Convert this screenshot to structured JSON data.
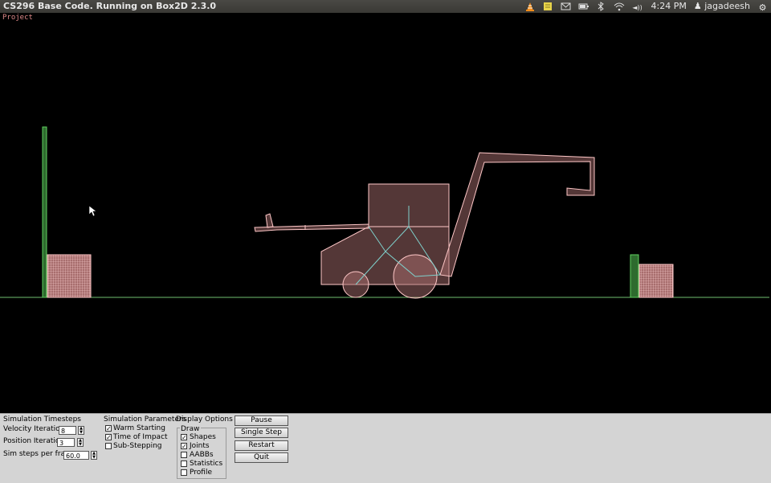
{
  "window": {
    "title": "CS296 Base Code. Running on Box2D 2.3.0"
  },
  "tray": {
    "time": "4:24 PM",
    "user": "jagadeesh",
    "volume_label": "◄))"
  },
  "scene": {
    "overlay_label": "Project"
  },
  "panel": {
    "timesteps": {
      "heading": "Simulation Timesteps",
      "velocity_label": "Velocity Iterations",
      "velocity_value": "8",
      "position_label": "Position Iterations",
      "position_value": "3",
      "steps_label": "Sim steps per frame",
      "steps_value": "60.0"
    },
    "parameters": {
      "heading": "Simulation Parameters",
      "items": [
        {
          "label": "Warm Starting",
          "checked": true
        },
        {
          "label": "Time of Impact",
          "checked": true
        },
        {
          "label": "Sub-Stepping",
          "checked": false
        }
      ]
    },
    "display": {
      "heading": "Display Options",
      "group": "Draw",
      "items": [
        {
          "label": "Shapes",
          "checked": true
        },
        {
          "label": "Joints",
          "checked": true
        },
        {
          "label": "AABBs",
          "checked": false
        },
        {
          "label": "Statistics",
          "checked": false
        },
        {
          "label": "Profile",
          "checked": false
        }
      ]
    },
    "buttons": {
      "pause": "Pause",
      "single_step": "Single Step",
      "restart": "Restart",
      "quit": "Quit"
    }
  },
  "colors": {
    "body_fill": "#a86e6e",
    "body_stroke": "#ffc8c8",
    "joint": "#7fd1cc",
    "static": "#2e6b2e",
    "ground": "#6fbf6f"
  }
}
